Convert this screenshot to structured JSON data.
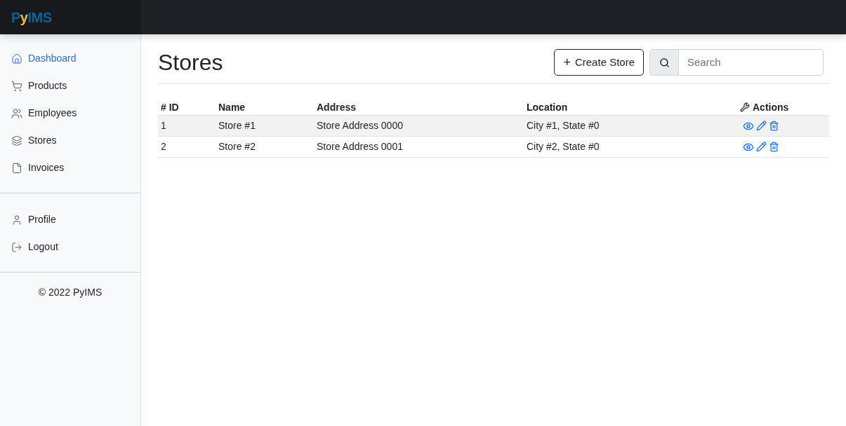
{
  "logo": {
    "parts": [
      {
        "text": "P",
        "color": "#0d6394"
      },
      {
        "text": "y",
        "color": "#f4c430"
      },
      {
        "text": "IMS",
        "color": "#0d6394"
      }
    ]
  },
  "sidebar": {
    "items": [
      {
        "label": "Dashboard",
        "selected": true
      },
      {
        "label": "Products",
        "selected": false
      },
      {
        "label": "Employees",
        "selected": false
      },
      {
        "label": "Stores",
        "selected": false
      },
      {
        "label": "Invoices",
        "selected": false
      }
    ],
    "account_items": [
      {
        "label": "Profile",
        "selected": false
      },
      {
        "label": "Logout",
        "selected": false
      }
    ],
    "footer": "© 2022 PyIMS"
  },
  "page": {
    "title": "Stores",
    "create_button": "Create Store",
    "create_icon": "+",
    "search": {
      "placeholder": "Search"
    }
  },
  "table": {
    "columns": [
      "# ID",
      "Name",
      "Address",
      "Location",
      "Actions"
    ],
    "rows": [
      {
        "cells": [
          "1",
          "Store #1",
          "Store Address 0000",
          "City #1, State #0"
        ],
        "highlighted": true
      },
      {
        "cells": [
          "2",
          "Store #2",
          "Store Address 0001",
          "City #2, State #0"
        ],
        "highlighted": false
      }
    ]
  }
}
